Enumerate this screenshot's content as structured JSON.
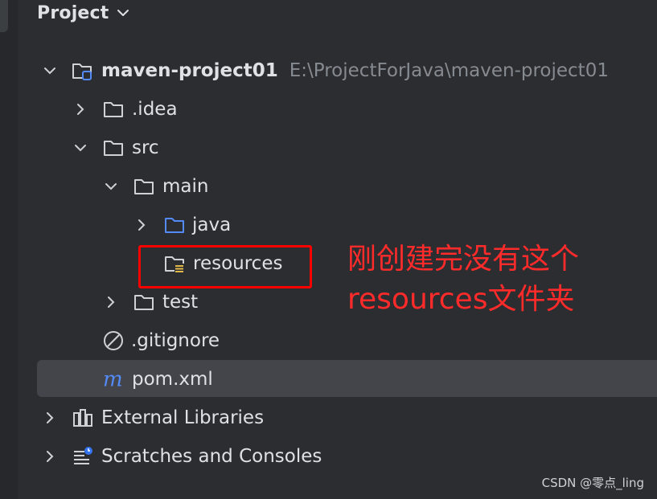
{
  "header": {
    "title": "Project"
  },
  "tree": {
    "root": {
      "name": "maven-project01",
      "path": "E:\\ProjectForJava\\maven-project01"
    },
    "items": [
      {
        "label": ".idea"
      },
      {
        "label": "src"
      },
      {
        "label": "main"
      },
      {
        "label": "java"
      },
      {
        "label": "resources"
      },
      {
        "label": "test"
      },
      {
        "label": ".gitignore"
      },
      {
        "label": "pom.xml"
      },
      {
        "label": "External Libraries"
      },
      {
        "label": "Scratches and Consoles"
      }
    ],
    "selected": "pom.xml"
  },
  "annotation": {
    "line1": "刚创建完没有这个",
    "line2": "resources文件夹"
  },
  "watermark": "CSDN @零点_ling",
  "colors": {
    "background": "#2b2d30",
    "selection": "#43454a",
    "annotation_red": "#ff0000",
    "java_folder_blue": "#548af7",
    "maven_blue": "#548af7",
    "scratch_badge_blue": "#3574f0"
  }
}
